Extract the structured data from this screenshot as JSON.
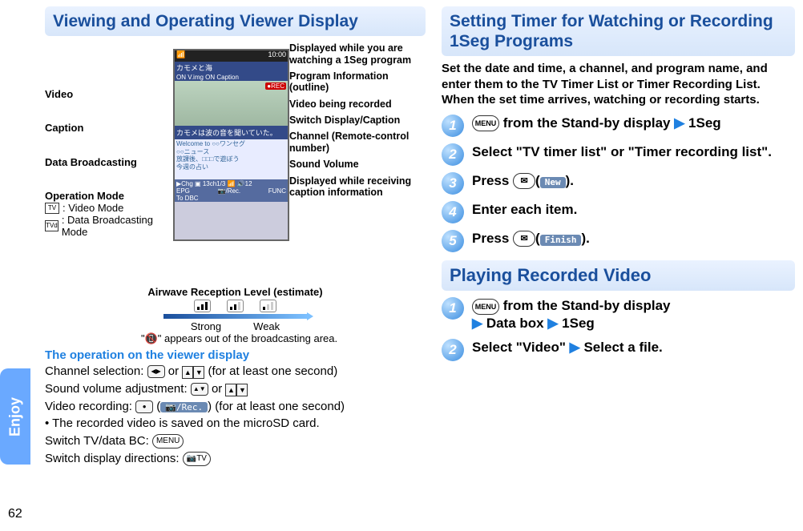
{
  "page_number": "62",
  "sidebar_tab": "Enjoy",
  "left": {
    "heading": "Viewing and Operating Viewer Display",
    "labels_left": {
      "video": "Video",
      "caption": "Caption",
      "data_broadcasting": "Data Broadcasting",
      "operation_mode": "Operation Mode",
      "video_mode": ": Video Mode",
      "data_mode": ": Data Broadcasting Mode"
    },
    "labels_right": {
      "watching_1seg": "Displayed while you are watching a 1Seg program",
      "program_info": "Program Information (outline)",
      "video_recording": "Video being recorded",
      "switch_display": "Switch Display/Caption",
      "channel": "Channel (Remote-control number)",
      "sound_volume": "Sound Volume",
      "caption_info": "Displayed while receiving caption information"
    },
    "airwave_title": "Airwave Reception Level (estimate)",
    "strong": "Strong",
    "weak": "Weak",
    "out_of_area_note": "\"📵\" appears out of the broadcasting area.",
    "op_heading": "The operation on the viewer display",
    "channel_selection": "Channel selection: ",
    "channel_selection_suffix": " (for at least one second)",
    "sound_adjust": "Sound volume adjustment: ",
    "video_record": "Video recording: ",
    "video_record_soft": "📷/Rec.",
    "video_record_suffix": "(for at least one second)",
    "video_save_note": " • The recorded video is saved on the microSD card.",
    "switch_tv_line": "Switch TV/data BC: ",
    "switch_dir_line": "Switch display directions: ",
    "menu_label": "MENU",
    "cam_tv_label": "📷TV",
    "or_word": " or ",
    "screen": {
      "status_left": "📶",
      "status_right": "10:00",
      "title": "カモメと海",
      "subbar_left": "ON V.img ON Caption",
      "rec": "●REC",
      "caption_text": "カモメは波の音を聞いていた。",
      "data_l1": "Welcome to ○○ワンセグ",
      "data_l2": "○○ニュース",
      "data_l3": "放課後、□□□で遊ぼう",
      "data_l4": "今週の占い",
      "bottom_icons": "▶Chg ▣ 13ch1/3 📶 🔊12",
      "bottom_row_left": "EPG",
      "bottom_row_mid": "📷/Rec.",
      "bottom_row_right": "FUNC",
      "bottom_row2_left": "To DBC"
    }
  },
  "right": {
    "heading": "Setting Timer for Watching or Recording 1Seg Programs",
    "intro": "Set the date and time, a channel, and program name, and enter them to the TV Timer List or Timer Recording List. When the set time arrives, watching or recording starts.",
    "steps_timer": {
      "s1_prefix": " from the Stand-by display",
      "s1_suffix": "1Seg",
      "s2": "Select \"TV timer list\" or \"Timer recording list\".",
      "s3_prefix": "Press ",
      "s3_soft": "New",
      "s3_suffix": ".",
      "s4": "Enter each item.",
      "s5_prefix": "Press ",
      "s5_soft": "Finish",
      "s5_suffix": "."
    },
    "heading2": "Playing Recorded Video",
    "steps_play": {
      "s1_prefix": " from the Stand-by display",
      "s1_mid": "Data box",
      "s1_suffix": "1Seg",
      "s2_prefix": "Select \"Video\"",
      "s2_suffix": "Select a file."
    },
    "menu_label": "MENU",
    "mail_glyph": "✉"
  }
}
